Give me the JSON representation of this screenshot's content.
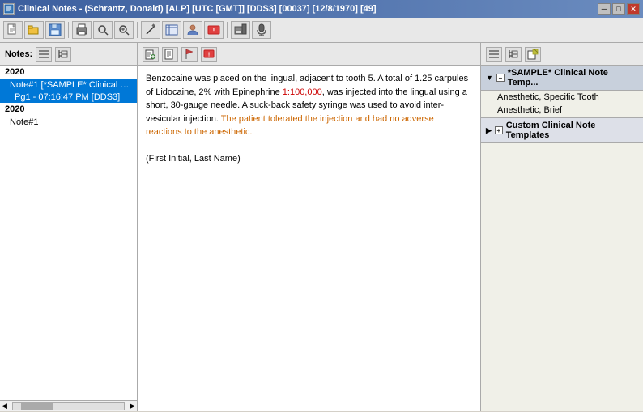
{
  "titleBar": {
    "icon": "📋",
    "title": "Clinical Notes - (Schrantz, Donald) [ALP] [UTC [GMT]] [DDS3] [00037] [12/8/1970] [49]",
    "appName": "Clinical Notes",
    "controls": {
      "minimize": "─",
      "maximize": "□",
      "close": "✕"
    }
  },
  "toolbar": {
    "buttons": [
      {
        "name": "new",
        "icon": "📄"
      },
      {
        "name": "open",
        "icon": "📂"
      },
      {
        "name": "save",
        "icon": "💾"
      },
      {
        "name": "print",
        "icon": "🖨"
      },
      {
        "name": "cut",
        "icon": "✂"
      },
      {
        "name": "copy",
        "icon": "📋"
      },
      {
        "name": "paste",
        "icon": "📌"
      },
      {
        "name": "undo",
        "icon": "↩"
      },
      {
        "name": "redo",
        "icon": "↪"
      },
      {
        "name": "bold",
        "icon": "B"
      },
      {
        "name": "italic",
        "icon": "I"
      },
      {
        "name": "underline",
        "icon": "U"
      },
      {
        "name": "find",
        "icon": "🔍"
      },
      {
        "name": "person",
        "icon": "👤"
      },
      {
        "name": "flag",
        "icon": "🚩"
      },
      {
        "name": "printer2",
        "icon": "🖨"
      },
      {
        "name": "message",
        "icon": "💬"
      }
    ]
  },
  "notesPanel": {
    "label": "Notes:",
    "years": [
      {
        "year": "2020",
        "notes": [
          {
            "id": "note1",
            "label": "Note#1 [*SAMPLE* Clinical Not",
            "selected": true,
            "subItems": [
              {
                "label": "Pg1 - 07:16:47 PM [DDS3]",
                "selected": true
              }
            ]
          }
        ]
      },
      {
        "year": "2020",
        "notes": [
          {
            "id": "note2",
            "label": "Note#1",
            "selected": false,
            "subItems": []
          }
        ]
      }
    ]
  },
  "noteContent": {
    "text": "Benzocaine was placed on the lingual, adjacent to tooth 5. A total of 1.25 carpules of Lidocaine, 2% with Epinephrine 1:100,000, was injected into the lingual using a short, 30-gauge needle. A suck-back safety syringe was used to avoid inter-vesicular injection. The patient tolerated the injection and had no adverse reactions to the anesthetic.",
    "signature": "(First Initial, Last Name)",
    "highlightedPhrases": [
      "1:100,000",
      "The patient tolerated the injection and had no adverse reactions to the anesthetic."
    ]
  },
  "templatesPanel": {
    "groups": [
      {
        "name": "*SAMPLE* Clinical Note Temp...",
        "expanded": true,
        "items": [
          {
            "label": "Anesthetic, Specific Tooth"
          },
          {
            "label": "Anesthetic, Brief"
          }
        ]
      }
    ],
    "customGroup": {
      "name": "Custom Clinical Note Templates",
      "expanded": false,
      "items": []
    }
  },
  "icons": {
    "expand": "▶",
    "collapse": "▼",
    "minus": "−",
    "plus": "+",
    "scrollLeft": "◀",
    "scrollRight": "▶"
  }
}
